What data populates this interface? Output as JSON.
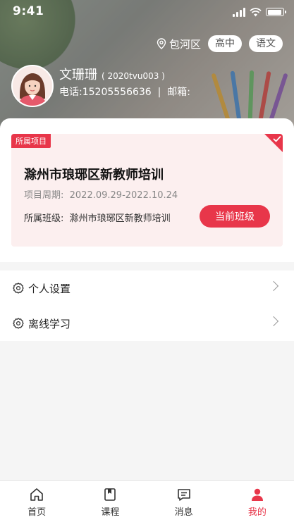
{
  "status_bar": {
    "time": "9:41"
  },
  "header": {
    "location": "包河区",
    "chips": [
      "高中",
      "语文"
    ],
    "user": {
      "name": "文珊珊",
      "id": "( 2020tvu003 )",
      "contact": "电话:15205556636  |  邮箱:"
    }
  },
  "project_card": {
    "tag": "所属项目",
    "title": "滁州市琅琊区新教师培训",
    "period": "项目周期:  2022.09.29-2022.10.24",
    "class_label": "所属班级:  滁州市琅琊区新教师培训",
    "button_label": "当前班级"
  },
  "menu": [
    {
      "label": "个人设置",
      "icon": "gear-icon"
    },
    {
      "label": "离线学习",
      "icon": "gear-icon"
    }
  ],
  "tabbar": [
    {
      "label": "首页",
      "icon": "home-icon",
      "active": false
    },
    {
      "label": "课程",
      "icon": "book-icon",
      "active": false
    },
    {
      "label": "消息",
      "icon": "message-icon",
      "active": false
    },
    {
      "label": "我的",
      "icon": "person-icon",
      "active": true
    }
  ],
  "colors": {
    "accent": "#e8364a",
    "card_bg": "#fcefef"
  }
}
